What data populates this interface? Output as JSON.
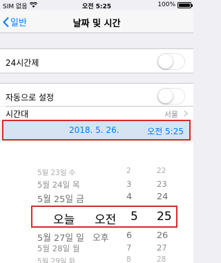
{
  "status_bar": {
    "carrier": "SIM 없음",
    "time": "오전 5:25",
    "battery_percent": "100%",
    "battery_level": 1.0,
    "wifi_icon": "wifi-icon"
  },
  "nav": {
    "back_label": "일반",
    "title": "날짜 및 시간"
  },
  "settings": {
    "hour24_label": "24시간제",
    "hour24_on": false,
    "auto_label": "자동으로 설정",
    "auto_on": false,
    "timezone_label": "시간대",
    "timezone_value": "서울"
  },
  "date_row": {
    "date": "2018. 5. 26.",
    "time": "오전 5:25"
  },
  "picker": {
    "rows_above": [
      {
        "date": "5월 23일 수",
        "ampm": "",
        "hour": "2",
        "minute": "22"
      },
      {
        "date": "5월 24일 목",
        "ampm": "",
        "hour": "3",
        "minute": "23"
      },
      {
        "date": "5월 24일 목",
        "ampm": "",
        "hour": "3",
        "minute": "23"
      },
      {
        "date": "5월 25일 금",
        "ampm": "",
        "hour": "4",
        "minute": "24"
      }
    ],
    "selected": {
      "date": "오늘",
      "ampm": "오전",
      "hour": "5",
      "minute": "25"
    },
    "rows_below": [
      {
        "date": "5월 27일 일",
        "ampm": "오후",
        "hour": "6",
        "minute": "26"
      },
      {
        "date": "5월 28일 월",
        "ampm": "",
        "hour": "7",
        "minute": "27"
      },
      {
        "date": "5월 29일 화",
        "ampm": "",
        "hour": "8",
        "minute": "28"
      }
    ]
  },
  "colors": {
    "accent": "#007aff",
    "highlight_border": "#d42a2a",
    "date_row_bg": "#d7e3f3"
  }
}
